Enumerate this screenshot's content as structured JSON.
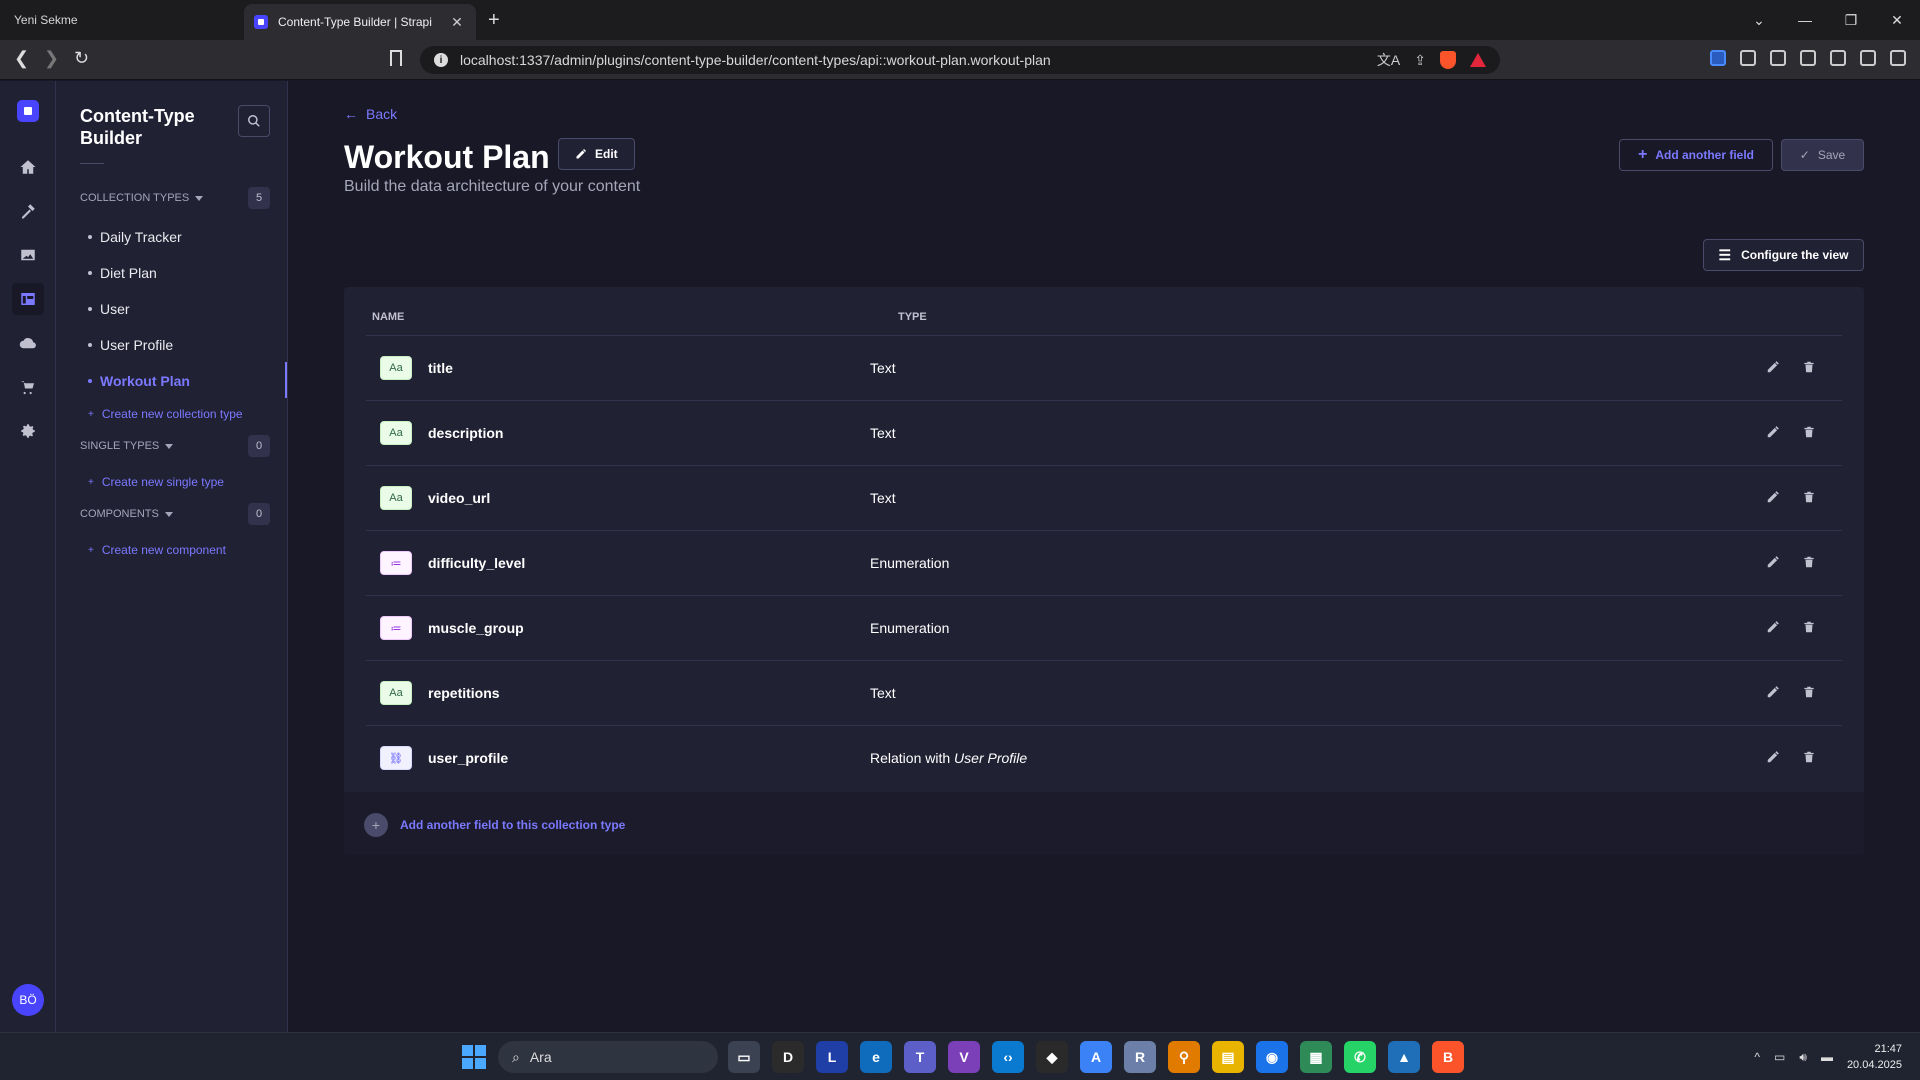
{
  "browser": {
    "inactive_tab_title": "Yeni Sekme",
    "active_tab_title": "Content-Type Builder | Strapi",
    "url": "localhost:1337/admin/plugins/content-type-builder/content-types/api::workout-plan.workout-plan"
  },
  "mainnav": {
    "avatar_initials": "BÖ"
  },
  "subnav": {
    "title": "Content-Type Builder",
    "collection_types_label": "Collection types",
    "collection_types_count": "5",
    "collection_items": [
      "Daily Tracker",
      "Diet Plan",
      "User",
      "User Profile",
      "Workout Plan"
    ],
    "create_collection_label": "Create new collection type",
    "single_types_label": "Single types",
    "single_types_count": "0",
    "create_single_label": "Create new single type",
    "components_label": "Components",
    "components_count": "0",
    "create_component_label": "Create new component"
  },
  "header": {
    "back_label": "Back",
    "title": "Workout Plan",
    "edit_label": "Edit",
    "subtitle": "Build the data architecture of your content",
    "add_field_label": "Add another field",
    "save_label": "Save",
    "configure_label": "Configure the view"
  },
  "table": {
    "col_name": "Name",
    "col_type": "Type",
    "rows": [
      {
        "icon_text": "Aa",
        "name": "title",
        "type": "Text"
      },
      {
        "icon_text": "Aa",
        "name": "description",
        "type": "Text"
      },
      {
        "icon_text": "Aa",
        "name": "video_url",
        "type": "Text"
      },
      {
        "icon_text": "≔",
        "name": "difficulty_level",
        "type": "Enumeration"
      },
      {
        "icon_text": "≔",
        "name": "muscle_group",
        "type": "Enumeration"
      },
      {
        "icon_text": "Aa",
        "name": "repetitions",
        "type": "Text"
      },
      {
        "icon_text": "⛓",
        "name": "user_profile",
        "type_prefix": "Relation with",
        "type_target": "User Profile"
      }
    ],
    "footer_label": "Add another field to this collection type"
  },
  "taskbar": {
    "search_label": "Ara",
    "time": "21:47",
    "date": "20.04.2025"
  }
}
